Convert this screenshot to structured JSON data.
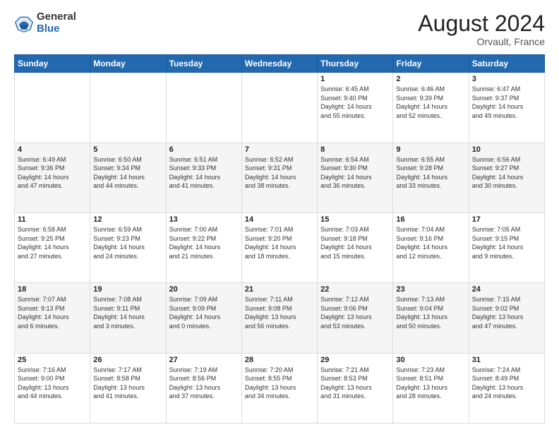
{
  "header": {
    "logo_general": "General",
    "logo_blue": "Blue",
    "month_title": "August 2024",
    "location": "Orvault, France"
  },
  "days_of_week": [
    "Sunday",
    "Monday",
    "Tuesday",
    "Wednesday",
    "Thursday",
    "Friday",
    "Saturday"
  ],
  "weeks": [
    [
      {
        "day": "",
        "info": ""
      },
      {
        "day": "",
        "info": ""
      },
      {
        "day": "",
        "info": ""
      },
      {
        "day": "",
        "info": ""
      },
      {
        "day": "1",
        "info": "Sunrise: 6:45 AM\nSunset: 9:40 PM\nDaylight: 14 hours\nand 55 minutes."
      },
      {
        "day": "2",
        "info": "Sunrise: 6:46 AM\nSunset: 9:39 PM\nDaylight: 14 hours\nand 52 minutes."
      },
      {
        "day": "3",
        "info": "Sunrise: 6:47 AM\nSunset: 9:37 PM\nDaylight: 14 hours\nand 49 minutes."
      }
    ],
    [
      {
        "day": "4",
        "info": "Sunrise: 6:49 AM\nSunset: 9:36 PM\nDaylight: 14 hours\nand 47 minutes."
      },
      {
        "day": "5",
        "info": "Sunrise: 6:50 AM\nSunset: 9:34 PM\nDaylight: 14 hours\nand 44 minutes."
      },
      {
        "day": "6",
        "info": "Sunrise: 6:51 AM\nSunset: 9:33 PM\nDaylight: 14 hours\nand 41 minutes."
      },
      {
        "day": "7",
        "info": "Sunrise: 6:52 AM\nSunset: 9:31 PM\nDaylight: 14 hours\nand 38 minutes."
      },
      {
        "day": "8",
        "info": "Sunrise: 6:54 AM\nSunset: 9:30 PM\nDaylight: 14 hours\nand 36 minutes."
      },
      {
        "day": "9",
        "info": "Sunrise: 6:55 AM\nSunset: 9:28 PM\nDaylight: 14 hours\nand 33 minutes."
      },
      {
        "day": "10",
        "info": "Sunrise: 6:56 AM\nSunset: 9:27 PM\nDaylight: 14 hours\nand 30 minutes."
      }
    ],
    [
      {
        "day": "11",
        "info": "Sunrise: 6:58 AM\nSunset: 9:25 PM\nDaylight: 14 hours\nand 27 minutes."
      },
      {
        "day": "12",
        "info": "Sunrise: 6:59 AM\nSunset: 9:23 PM\nDaylight: 14 hours\nand 24 minutes."
      },
      {
        "day": "13",
        "info": "Sunrise: 7:00 AM\nSunset: 9:22 PM\nDaylight: 14 hours\nand 21 minutes."
      },
      {
        "day": "14",
        "info": "Sunrise: 7:01 AM\nSunset: 9:20 PM\nDaylight: 14 hours\nand 18 minutes."
      },
      {
        "day": "15",
        "info": "Sunrise: 7:03 AM\nSunset: 9:18 PM\nDaylight: 14 hours\nand 15 minutes."
      },
      {
        "day": "16",
        "info": "Sunrise: 7:04 AM\nSunset: 9:16 PM\nDaylight: 14 hours\nand 12 minutes."
      },
      {
        "day": "17",
        "info": "Sunrise: 7:05 AM\nSunset: 9:15 PM\nDaylight: 14 hours\nand 9 minutes."
      }
    ],
    [
      {
        "day": "18",
        "info": "Sunrise: 7:07 AM\nSunset: 9:13 PM\nDaylight: 14 hours\nand 6 minutes."
      },
      {
        "day": "19",
        "info": "Sunrise: 7:08 AM\nSunset: 9:11 PM\nDaylight: 14 hours\nand 3 minutes."
      },
      {
        "day": "20",
        "info": "Sunrise: 7:09 AM\nSunset: 9:09 PM\nDaylight: 14 hours\nand 0 minutes."
      },
      {
        "day": "21",
        "info": "Sunrise: 7:11 AM\nSunset: 9:08 PM\nDaylight: 13 hours\nand 56 minutes."
      },
      {
        "day": "22",
        "info": "Sunrise: 7:12 AM\nSunset: 9:06 PM\nDaylight: 13 hours\nand 53 minutes."
      },
      {
        "day": "23",
        "info": "Sunrise: 7:13 AM\nSunset: 9:04 PM\nDaylight: 13 hours\nand 50 minutes."
      },
      {
        "day": "24",
        "info": "Sunrise: 7:15 AM\nSunset: 9:02 PM\nDaylight: 13 hours\nand 47 minutes."
      }
    ],
    [
      {
        "day": "25",
        "info": "Sunrise: 7:16 AM\nSunset: 9:00 PM\nDaylight: 13 hours\nand 44 minutes."
      },
      {
        "day": "26",
        "info": "Sunrise: 7:17 AM\nSunset: 8:58 PM\nDaylight: 13 hours\nand 41 minutes."
      },
      {
        "day": "27",
        "info": "Sunrise: 7:19 AM\nSunset: 8:56 PM\nDaylight: 13 hours\nand 37 minutes."
      },
      {
        "day": "28",
        "info": "Sunrise: 7:20 AM\nSunset: 8:55 PM\nDaylight: 13 hours\nand 34 minutes."
      },
      {
        "day": "29",
        "info": "Sunrise: 7:21 AM\nSunset: 8:53 PM\nDaylight: 13 hours\nand 31 minutes."
      },
      {
        "day": "30",
        "info": "Sunrise: 7:23 AM\nSunset: 8:51 PM\nDaylight: 13 hours\nand 28 minutes."
      },
      {
        "day": "31",
        "info": "Sunrise: 7:24 AM\nSunset: 8:49 PM\nDaylight: 13 hours\nand 24 minutes."
      }
    ]
  ]
}
